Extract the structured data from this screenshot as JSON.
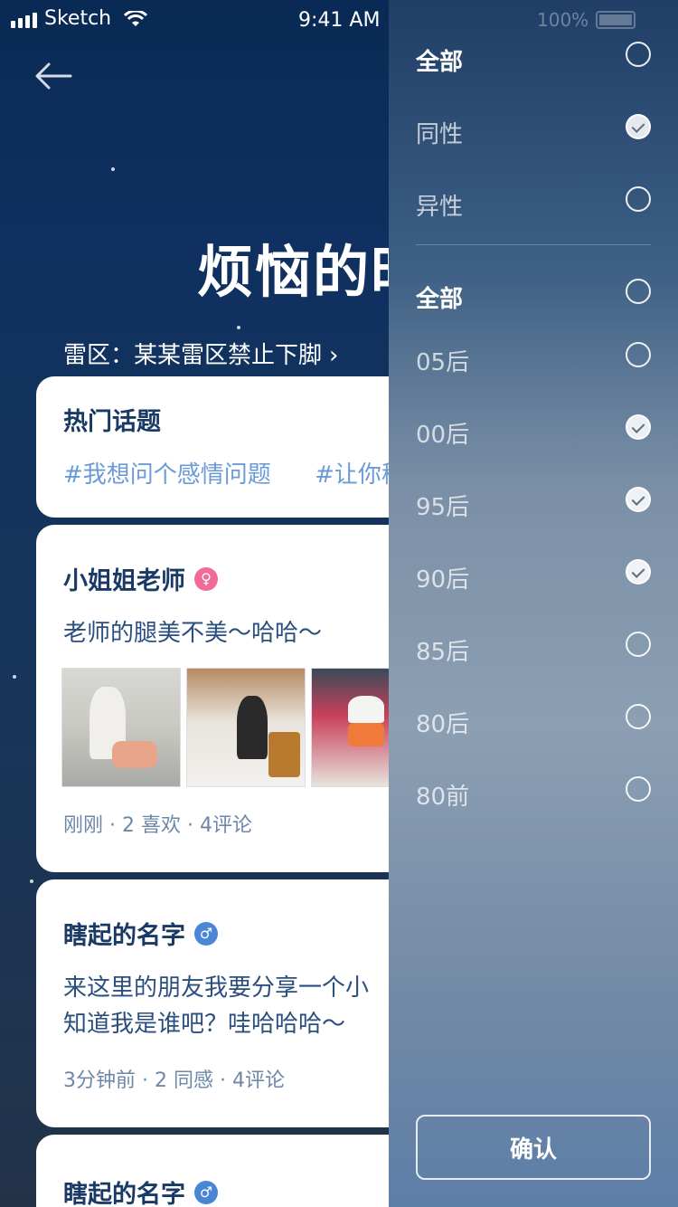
{
  "status_bar": {
    "carrier": "Sketch",
    "time": "9:41 AM",
    "battery": "100%"
  },
  "page": {
    "title": "烦恼的时",
    "rule_link": "雷区：某某雷区禁止下脚"
  },
  "hot_topics": {
    "title": "热门话题",
    "tags": [
      "#我想问个感情问题",
      "#让你秘"
    ]
  },
  "posts": [
    {
      "author": "小姐姐老师",
      "gender": "female",
      "content_lines": [
        "老师的腿美不美～哈哈～"
      ],
      "meta": "刚刚 · 2 喜欢 · 4评论",
      "has_images": true
    },
    {
      "author": "瞎起的名字",
      "gender": "male",
      "content_lines": [
        "来这里的朋友我要分享一个小",
        "知道我是谁吧？哇哈哈哈～"
      ],
      "meta": "3分钟前 · 2 同感 · 4评论"
    },
    {
      "author": "瞎起的名字",
      "gender": "male"
    }
  ],
  "filter": {
    "gender_options": [
      {
        "label": "全部",
        "checked": false,
        "strong": true
      },
      {
        "label": "同性",
        "checked": true,
        "strong": false
      },
      {
        "label": "异性",
        "checked": false,
        "strong": false
      }
    ],
    "age_options": [
      {
        "label": "全部",
        "checked": false,
        "strong": true
      },
      {
        "label": "05后",
        "checked": false,
        "strong": false
      },
      {
        "label": "00后",
        "checked": true,
        "strong": false
      },
      {
        "label": "95后",
        "checked": true,
        "strong": false
      },
      {
        "label": "90后",
        "checked": true,
        "strong": false
      },
      {
        "label": "85后",
        "checked": false,
        "strong": false
      },
      {
        "label": "80后",
        "checked": false,
        "strong": false
      },
      {
        "label": "80前",
        "checked": false,
        "strong": false
      }
    ],
    "confirm_label": "确认"
  }
}
